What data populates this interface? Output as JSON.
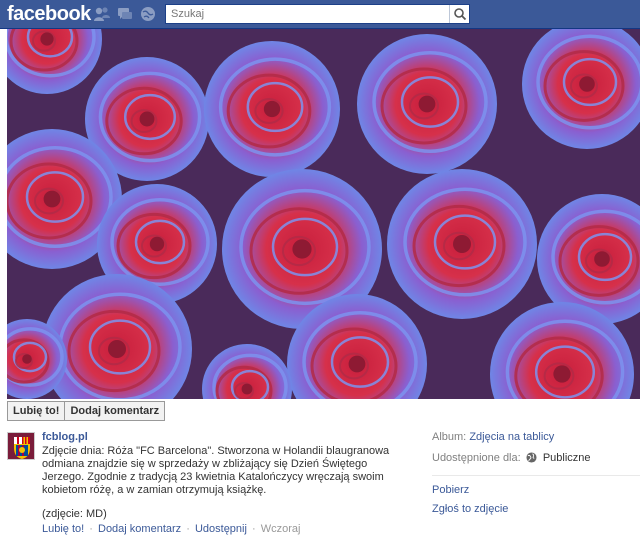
{
  "header": {
    "logo": "facebook",
    "search": {
      "placeholder": "Szukaj"
    },
    "icons": [
      "friend-requests-icon",
      "messages-icon",
      "notifications-icon",
      "search-icon"
    ]
  },
  "photo": {
    "subject": "blue-red-roses-photo"
  },
  "actions": {
    "like_label": "Lubię to!",
    "comment_label": "Dodaj komentarz"
  },
  "post": {
    "author": "fcblog.pl",
    "caption": "Zdjęcie dnia: Róża \"FC Barcelona\". Stworzona w Holandii blaugranowa odmiana znajdzie się w sprzedaży w zbliżający się Dzień Świętego Jerzego. Zgodnie z tradycją 23 kwietnia Katalończycy wręczają swoim kobietom różę, a w zamian otrzymują książkę.",
    "source": "(zdjęcie: MD)",
    "links": {
      "like": "Lubię to!",
      "comment": "Dodaj komentarz",
      "share": "Udostępnij",
      "time": "Wczoraj",
      "separator": "·"
    }
  },
  "sidebar": {
    "album_label": "Album:",
    "album_value": "Zdjęcia na tablicy",
    "shared_label": "Udostępnione dla:",
    "shared_value": "Publiczne",
    "download": "Pobierz",
    "report": "Zgłoś to zdjęcie"
  },
  "colors": {
    "brand": "#3b5998",
    "link": "#3b5998",
    "muted": "#808080"
  }
}
